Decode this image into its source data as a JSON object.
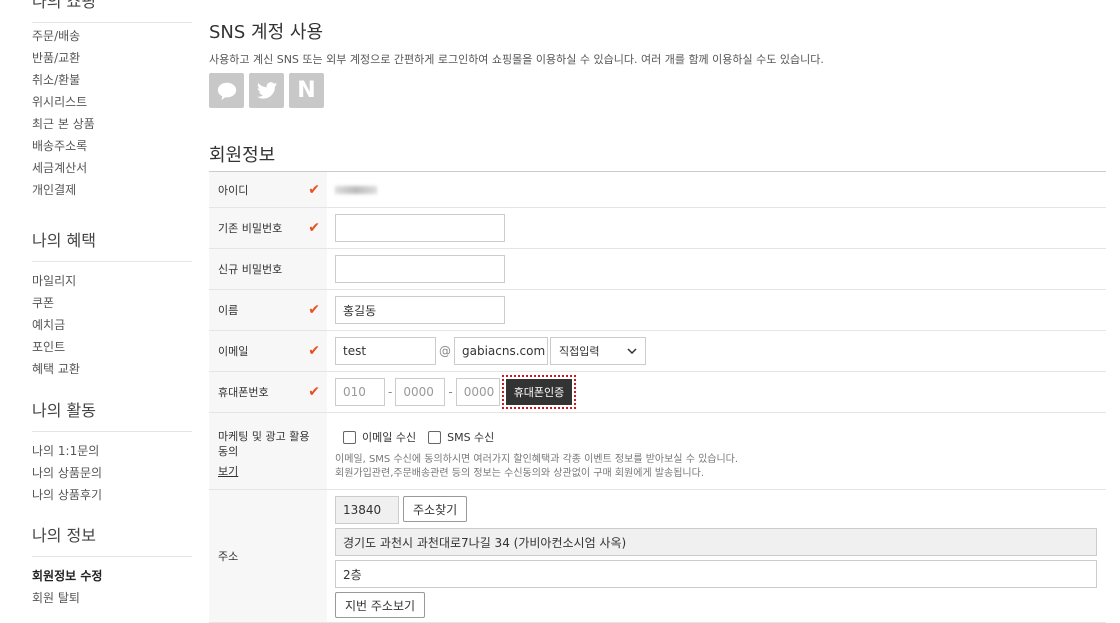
{
  "sidebar": {
    "groups": [
      {
        "title": "나의 쇼핑",
        "items": [
          "주문/배송",
          "반품/교환",
          "취소/환불",
          "위시리스트",
          "최근 본 상품",
          "배송주소록",
          "세금계산서",
          "개인결제"
        ]
      },
      {
        "title": "나의 혜택",
        "items": [
          "마일리지",
          "쿠폰",
          "예치금",
          "포인트",
          "혜택 교환"
        ]
      },
      {
        "title": "나의 활동",
        "items": [
          "나의 1:1문의",
          "나의 상품문의",
          "나의 상품후기"
        ]
      },
      {
        "title": "나의 정보",
        "items": [
          "회원정보 수정",
          "회원 탈퇴"
        ]
      }
    ]
  },
  "sns": {
    "title": "SNS 계정 사용",
    "description": "사용하고 계신 SNS 또는 외부 계정으로 간편하게 로그인하여 쇼핑몰을 이용하실 수 있습니다. 여러 개를 함께 이용하실 수도 있습니다.",
    "icons": [
      "kakao-talk-icon",
      "twitter-icon",
      "naver-icon"
    ],
    "naver_letter": "N"
  },
  "member_info": {
    "title": "회원정보",
    "required_mark": "✔",
    "labels": {
      "id": "아이디",
      "current_password": "기존 비밀번호",
      "new_password": "신규 비밀번호",
      "name": "이름",
      "email": "이메일",
      "phone": "휴대폰번호",
      "marketing": "마케팅 및 광고 활용 동의",
      "address": "주소"
    },
    "name_value": "홍길동",
    "email_local": "test",
    "email_at": "@",
    "email_domain": "gabiacns.com",
    "email_select": "직접입력",
    "phone_1": "010",
    "phone_2": "0000",
    "phone_3": "0000",
    "phone_dash": "-",
    "phone_verify_button": "휴대폰인증",
    "marketing_view_link": "보기",
    "email_receive": "이메일 수신",
    "sms_receive": "SMS 수신",
    "marketing_note_1": "이메일, SMS 수신에 동의하시면 여러가지 할인혜택과 각종 이벤트 정보를 받아보실 수 있습니다.",
    "marketing_note_2": "회원가입관련,주문배송관련 등의 정보는 수신동의와 상관없이 구매 회원에게 발송됩니다.",
    "zipcode": "13840",
    "find_address_button": "주소찾기",
    "address_1": "경기도 과천시 과천대로7나길 34 (가비아컨소시엄 사옥)",
    "address_2": "2층",
    "lot_address_button": "지번 주소보기"
  },
  "colors": {
    "check": "#e8501f",
    "verify_border": "#d0191e"
  }
}
